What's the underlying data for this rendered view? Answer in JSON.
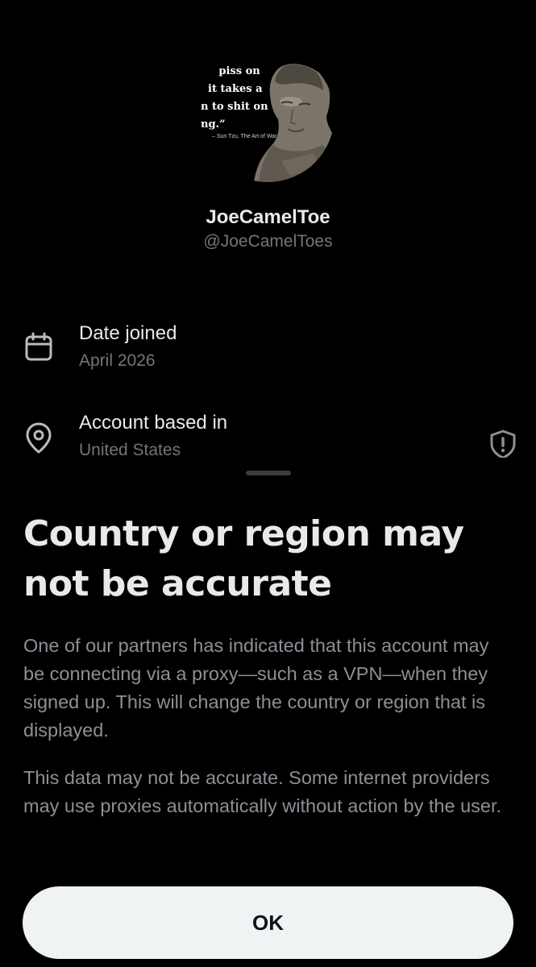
{
  "profile": {
    "avatar_quote_lines": [
      "an piss on",
      ", it takes a",
      "n to shit on",
      "ng.”"
    ],
    "avatar_quote_attribution": "– Sun Tzu, The Art of War",
    "display_name": "JoeCamelToe",
    "handle": "@JoeCamelToes"
  },
  "info": {
    "date_joined": {
      "icon": "calendar-icon",
      "title": "Date joined",
      "value": "April 2026"
    },
    "account_based": {
      "icon": "location-pin-icon",
      "title": "Account based in",
      "value": "United States",
      "warning_icon": "shield-alert-icon"
    }
  },
  "sheet": {
    "title": "Country or region may not be accurate",
    "paragraph_1": "One of our partners has indicated that this account may be connecting via a proxy—such as a VPN—when they signed up. This will change the country or region that is displayed.",
    "paragraph_2": "This data may not be accurate. Some internet providers may use proxies automatically without action by the user.",
    "ok_label": "OK"
  },
  "colors": {
    "background": "#000000",
    "primary_text": "#e7e9ea",
    "secondary_text": "#71767b",
    "body_text": "#8b9096",
    "button_bg": "#eff3f4",
    "button_text": "#0f1419"
  }
}
